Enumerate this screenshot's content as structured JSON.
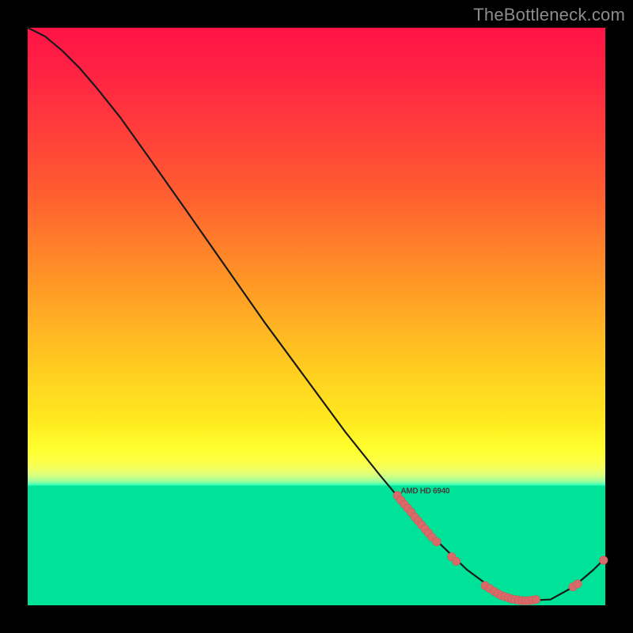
{
  "watermark": "TheBottleneck.com",
  "colors": {
    "curve": "#1a1a1a",
    "marker_fill": "#d96a6a",
    "marker_stroke": "#c95a5a",
    "gpu_label_color": "#404040"
  },
  "gpu_label": {
    "text": "AMD HD 6940",
    "x_frac": 0.688,
    "y_frac": 0.803
  },
  "chart_data": {
    "type": "line",
    "title": "",
    "xlabel": "",
    "ylabel": "",
    "xlim": [
      0,
      1
    ],
    "ylim": [
      0,
      1
    ],
    "note": "Fractions of plot area; curve is bottleneck %, markers are GPU models clustered near minimum.",
    "curve": [
      {
        "x": 0.0,
        "y": 1.0
      },
      {
        "x": 0.03,
        "y": 0.985
      },
      {
        "x": 0.06,
        "y": 0.96
      },
      {
        "x": 0.09,
        "y": 0.93
      },
      {
        "x": 0.12,
        "y": 0.895
      },
      {
        "x": 0.16,
        "y": 0.845
      },
      {
        "x": 0.21,
        "y": 0.775
      },
      {
        "x": 0.27,
        "y": 0.69
      },
      {
        "x": 0.34,
        "y": 0.59
      },
      {
        "x": 0.41,
        "y": 0.49
      },
      {
        "x": 0.48,
        "y": 0.395
      },
      {
        "x": 0.55,
        "y": 0.3
      },
      {
        "x": 0.61,
        "y": 0.225
      },
      {
        "x": 0.66,
        "y": 0.165
      },
      {
        "x": 0.71,
        "y": 0.11
      },
      {
        "x": 0.76,
        "y": 0.062
      },
      {
        "x": 0.81,
        "y": 0.025
      },
      {
        "x": 0.86,
        "y": 0.008
      },
      {
        "x": 0.905,
        "y": 0.01
      },
      {
        "x": 0.945,
        "y": 0.032
      },
      {
        "x": 0.98,
        "y": 0.062
      },
      {
        "x": 1.0,
        "y": 0.082
      }
    ],
    "markers": [
      {
        "x": 0.64,
        "y": 0.19
      },
      {
        "x": 0.646,
        "y": 0.182
      },
      {
        "x": 0.652,
        "y": 0.175
      },
      {
        "x": 0.658,
        "y": 0.168
      },
      {
        "x": 0.664,
        "y": 0.161
      },
      {
        "x": 0.67,
        "y": 0.153
      },
      {
        "x": 0.676,
        "y": 0.146
      },
      {
        "x": 0.682,
        "y": 0.139
      },
      {
        "x": 0.688,
        "y": 0.132
      },
      {
        "x": 0.694,
        "y": 0.125
      },
      {
        "x": 0.7,
        "y": 0.118
      },
      {
        "x": 0.708,
        "y": 0.11
      },
      {
        "x": 0.734,
        "y": 0.084
      },
      {
        "x": 0.742,
        "y": 0.076
      },
      {
        "x": 0.792,
        "y": 0.034
      },
      {
        "x": 0.8,
        "y": 0.029
      },
      {
        "x": 0.808,
        "y": 0.024
      },
      {
        "x": 0.814,
        "y": 0.02
      },
      {
        "x": 0.82,
        "y": 0.017
      },
      {
        "x": 0.826,
        "y": 0.015
      },
      {
        "x": 0.832,
        "y": 0.013
      },
      {
        "x": 0.838,
        "y": 0.011
      },
      {
        "x": 0.844,
        "y": 0.01
      },
      {
        "x": 0.85,
        "y": 0.009
      },
      {
        "x": 0.856,
        "y": 0.008
      },
      {
        "x": 0.862,
        "y": 0.008
      },
      {
        "x": 0.868,
        "y": 0.008
      },
      {
        "x": 0.874,
        "y": 0.009
      },
      {
        "x": 0.88,
        "y": 0.01
      },
      {
        "x": 0.944,
        "y": 0.032
      },
      {
        "x": 0.952,
        "y": 0.037
      },
      {
        "x": 0.997,
        "y": 0.078
      }
    ]
  }
}
